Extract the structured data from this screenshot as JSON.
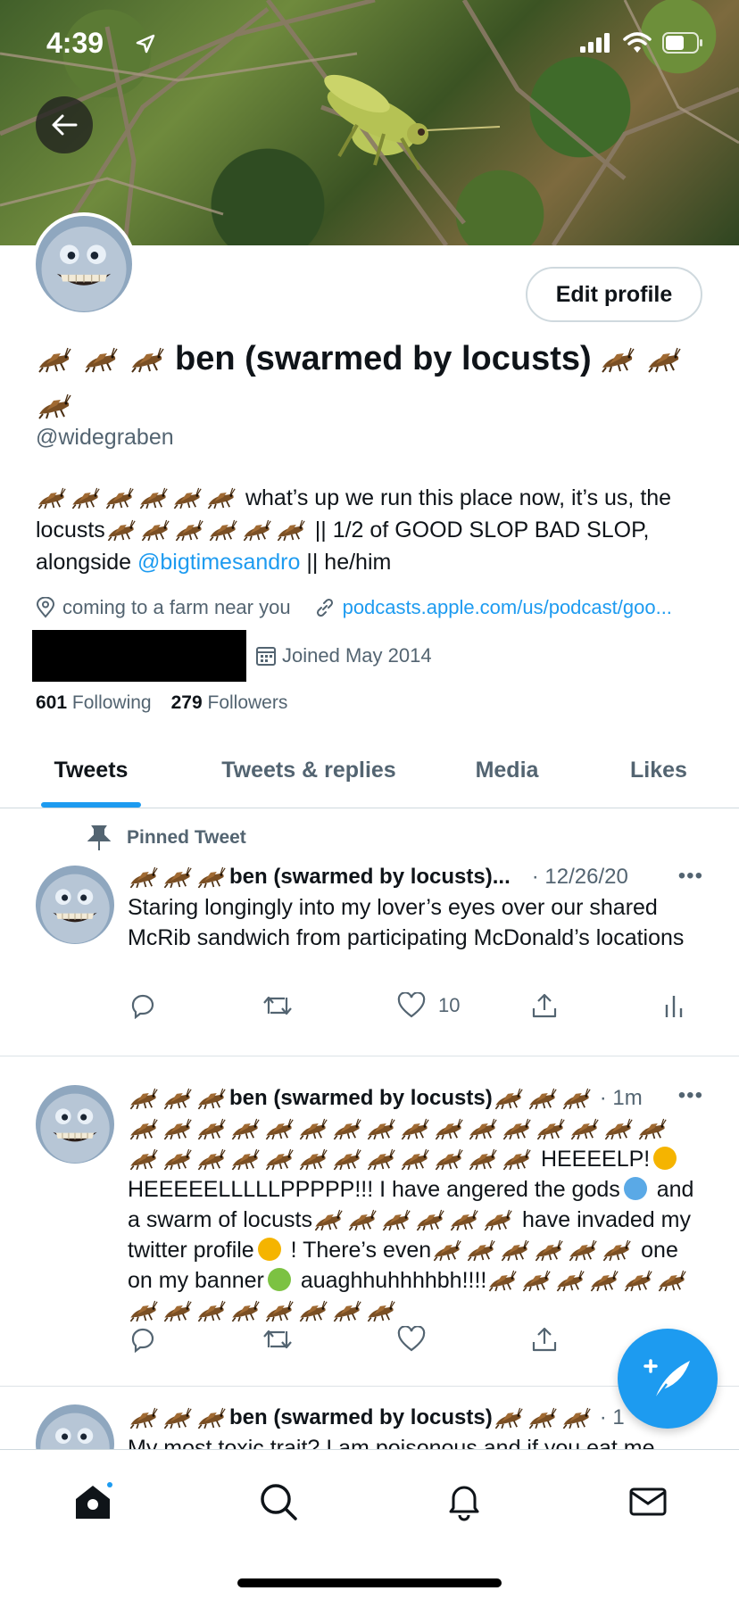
{
  "status_bar": {
    "time": "4:39"
  },
  "profile": {
    "display_name": "ben (swarmed by locusts)",
    "handle": "@widegraben",
    "bio": {
      "part1": "what’s up we run this place now, it’s us, the locusts",
      "part2": "|| 1/2 of GOOD SLOP BAD SLOP, alongside ",
      "mention": "@bigtimesandro",
      "part3": " || he/him"
    },
    "location": "coming to a farm near you",
    "website": "podcasts.apple.com/us/podcast/goo...",
    "joined": "Joined May 2014",
    "following_count": "601",
    "following_label": "Following",
    "followers_count": "279",
    "followers_label": "Followers",
    "edit_profile_label": "Edit profile"
  },
  "tabs": [
    {
      "label": "Tweets",
      "active": true
    },
    {
      "label": "Tweets & replies",
      "active": false
    },
    {
      "label": "Media",
      "active": false
    },
    {
      "label": "Likes",
      "active": false
    }
  ],
  "tweets": [
    {
      "pinned_label": "Pinned Tweet",
      "name": "ben (swarmed by locusts)...",
      "meta": "· 12/26/20",
      "text": "Staring longingly into my lover’s eyes over our shared McRib sandwich from participating McDonald’s locations",
      "like_count": "10"
    },
    {
      "name": "ben (swarmed by locusts)",
      "meta": "· 1m",
      "text_a": "HEEEELP!",
      "text_b": "HEEEEELLLLLPPPPP!!! I have angered the gods",
      "text_c": "and a swarm of locusts",
      "text_d": "have invaded my twitter profile",
      "text_e": "! There’s even",
      "text_f": "one on my banner",
      "text_g": "auaghhuhhhhbh!!!!"
    },
    {
      "name": "ben (swarmed by locusts)",
      "meta": "· 1",
      "text": "My most toxic trait? I am poisonous and if you eat me"
    }
  ],
  "icons": {
    "locust": "locust-icon",
    "back": "arrow-left-icon",
    "compose": "compose-tweet-icon"
  },
  "colors": {
    "accent": "#1d9bf0",
    "text": "#0f1419",
    "secondary": "#536471"
  }
}
